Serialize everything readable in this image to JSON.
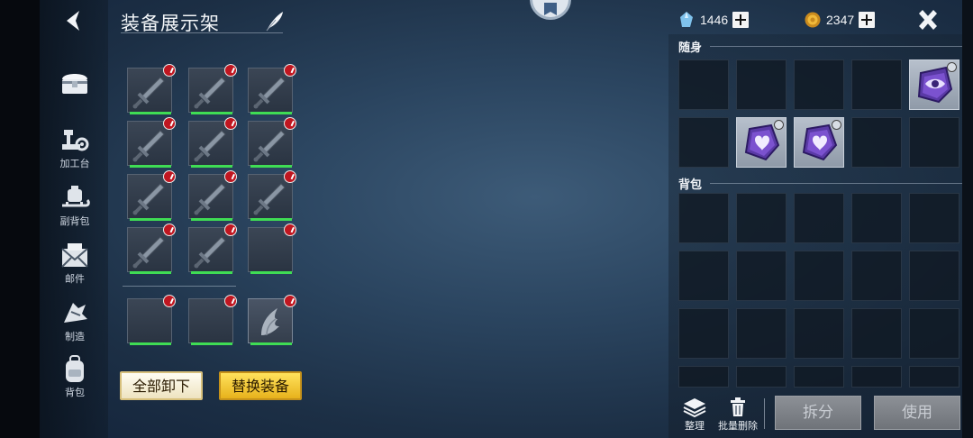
{
  "header": {
    "title": "装备展示架"
  },
  "nav": [
    {
      "id": "chest",
      "label": "",
      "icon": "chest-icon"
    },
    {
      "id": "workbench",
      "label": "加工台",
      "icon": "workbench-icon"
    },
    {
      "id": "sub-bag",
      "label": "副背包",
      "icon": "sled-icon"
    },
    {
      "id": "mail",
      "label": "邮件",
      "icon": "mail-icon"
    },
    {
      "id": "craft",
      "label": "制造",
      "icon": "craft-icon"
    },
    {
      "id": "bag",
      "label": "背包",
      "icon": "backpack-icon"
    }
  ],
  "display_rack": {
    "slots": [
      {
        "row": 0,
        "col": 0,
        "item": "sword-icon"
      },
      {
        "row": 0,
        "col": 1,
        "item": "sword-icon"
      },
      {
        "row": 0,
        "col": 2,
        "item": "sword-icon"
      },
      {
        "row": 1,
        "col": 0,
        "item": "sword-icon"
      },
      {
        "row": 1,
        "col": 1,
        "item": "sword-icon"
      },
      {
        "row": 1,
        "col": 2,
        "item": "sword-icon"
      },
      {
        "row": 2,
        "col": 0,
        "item": "sword-icon"
      },
      {
        "row": 2,
        "col": 1,
        "item": "sword-icon"
      },
      {
        "row": 2,
        "col": 2,
        "item": "sword-icon"
      },
      {
        "row": 3,
        "col": 0,
        "item": "sword-icon"
      },
      {
        "row": 3,
        "col": 1,
        "item": "sword-icon"
      },
      {
        "row": 3,
        "col": 2,
        "item": ""
      },
      {
        "row": 4,
        "col": 0,
        "item": ""
      },
      {
        "row": 4,
        "col": 1,
        "item": ""
      },
      {
        "row": 4,
        "col": 2,
        "item": "wing-icon"
      }
    ],
    "unequip_all_label": "全部卸下",
    "replace_label": "替换装备"
  },
  "currency": {
    "crystal": "1446",
    "gold": "2347"
  },
  "inventory": {
    "carry_label": "随身",
    "bag_label": "背包",
    "carry_items": {
      "0-4": "eye-gem-icon",
      "1-1": "heart-gem-icon",
      "1-2": "heart-gem-icon"
    },
    "sort_label": "整理",
    "batch_delete_label": "批量删除",
    "split_label": "拆分",
    "use_label": "使用"
  },
  "colors": {
    "durability_green": "#3fdc54",
    "badge_red": "#c01620",
    "gem_purple": "#6a3fb5",
    "button_gold": "#ffd63c"
  }
}
